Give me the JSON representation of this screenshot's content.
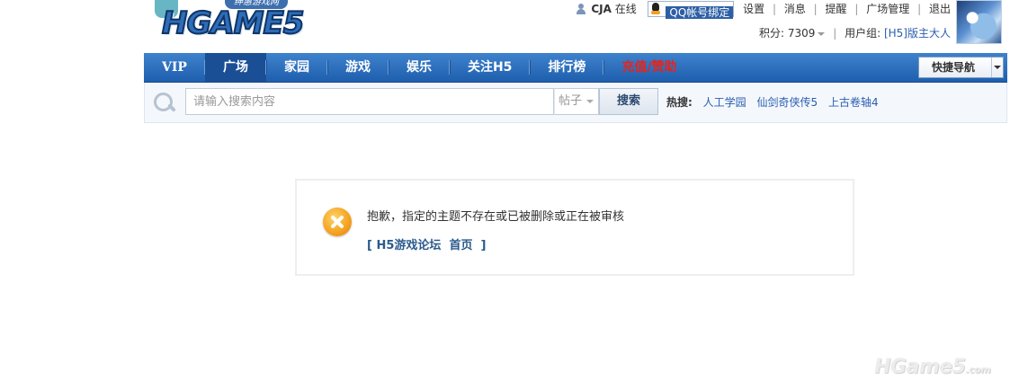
{
  "logo": {
    "tag": "绅惠游戏网",
    "text": "HGAME5"
  },
  "user_bar": {
    "username": "CJA",
    "status": "在线",
    "qq_bind": "QQ帐号绑定",
    "links": [
      "设置",
      "消息",
      "提醒",
      "广场管理",
      "退出"
    ]
  },
  "user_info": {
    "points_label": "积分: 7309",
    "group_label": "用户组:",
    "group_value": "[H5]版主大人"
  },
  "nav": {
    "items": [
      "VIP",
      "广场",
      "家园",
      "游戏",
      "娱乐",
      "关注H5",
      "排行榜",
      "充值/赞助"
    ],
    "active_index": 1,
    "accent_index": 7,
    "quick_nav": "快捷导航"
  },
  "search": {
    "placeholder": "请输入搜索内容",
    "type": "帖子",
    "button": "搜索",
    "hot_label": "热搜:",
    "hot_links": [
      "人工学园",
      "仙剑奇侠传5",
      "上古卷轴4"
    ]
  },
  "message": {
    "text": "抱歉，指定的主题不存在或已被删除或正在被审核",
    "back_link": "[ H5游戏论坛  首页  ]"
  },
  "watermark": {
    "text": "HGame5",
    "suffix": ".com"
  },
  "colors": {
    "nav_blue": "#2a6cbb",
    "accent_red": "#e8231a",
    "link_blue": "#2a5db0",
    "error_orange": "#f4a11e"
  }
}
